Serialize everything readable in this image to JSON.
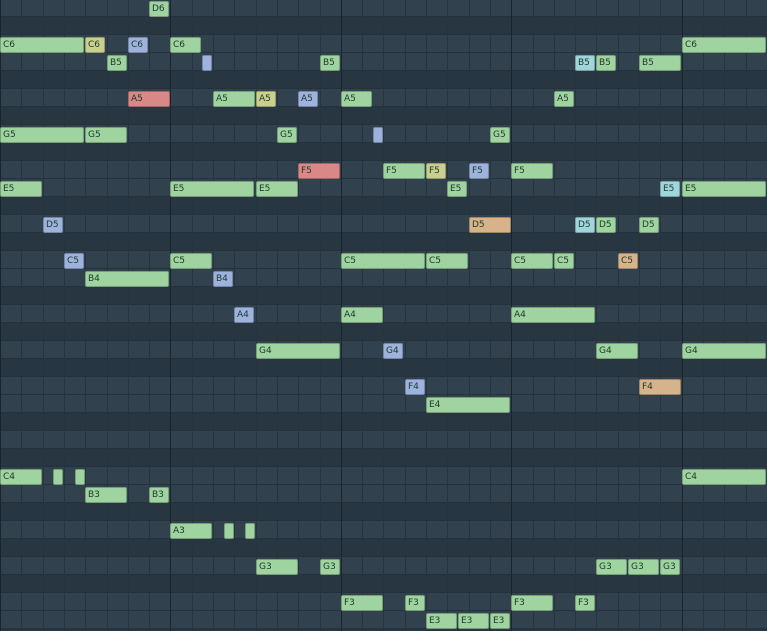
{
  "colors": {
    "green": "#9fd3a0",
    "yellow": "#c9cf8e",
    "blue": "#9db3de",
    "red": "#d98787",
    "tan": "#d6b38a",
    "cyan": "#9fd6dc"
  },
  "notes": [
    {
      "label": "D6",
      "color": "green"
    },
    {
      "label": "C6",
      "color": "green"
    },
    {
      "label": "C6",
      "color": "yellow"
    },
    {
      "label": "C6",
      "color": "blue"
    },
    {
      "label": "C6",
      "color": "green"
    },
    {
      "label": "C6",
      "color": "green"
    },
    {
      "label": "B5",
      "color": "green"
    },
    {
      "label": "",
      "color": "blue"
    },
    {
      "label": "B5",
      "color": "green"
    },
    {
      "label": "B5",
      "color": "cyan"
    },
    {
      "label": "B5",
      "color": "green"
    },
    {
      "label": "B5",
      "color": "green"
    },
    {
      "label": "A5",
      "color": "red"
    },
    {
      "label": "A5",
      "color": "green"
    },
    {
      "label": "A5",
      "color": "yellow"
    },
    {
      "label": "A5",
      "color": "blue"
    },
    {
      "label": "A5",
      "color": "green"
    },
    {
      "label": "A5",
      "color": "green"
    },
    {
      "label": "G5",
      "color": "green"
    },
    {
      "label": "G5",
      "color": "green"
    },
    {
      "label": "G5",
      "color": "green"
    },
    {
      "label": "",
      "color": "blue"
    },
    {
      "label": "G5",
      "color": "green"
    },
    {
      "label": "F5",
      "color": "red"
    },
    {
      "label": "F5",
      "color": "green"
    },
    {
      "label": "F5",
      "color": "yellow"
    },
    {
      "label": "F5",
      "color": "blue"
    },
    {
      "label": "F5",
      "color": "green"
    },
    {
      "label": "E5",
      "color": "green"
    },
    {
      "label": "E5",
      "color": "green"
    },
    {
      "label": "E5",
      "color": "green"
    },
    {
      "label": "E5",
      "color": "green"
    },
    {
      "label": "E5",
      "color": "cyan"
    },
    {
      "label": "E5",
      "color": "green"
    },
    {
      "label": "D5",
      "color": "blue"
    },
    {
      "label": "D5",
      "color": "tan"
    },
    {
      "label": "D5",
      "color": "cyan"
    },
    {
      "label": "D5",
      "color": "green"
    },
    {
      "label": "D5",
      "color": "green"
    },
    {
      "label": "C5",
      "color": "blue"
    },
    {
      "label": "C5",
      "color": "green"
    },
    {
      "label": "C5",
      "color": "green"
    },
    {
      "label": "C5",
      "color": "green"
    },
    {
      "label": "C5",
      "color": "green"
    },
    {
      "label": "C5",
      "color": "green"
    },
    {
      "label": "C5",
      "color": "tan"
    },
    {
      "label": "B4",
      "color": "green"
    },
    {
      "label": "B4",
      "color": "blue"
    },
    {
      "label": "A4",
      "color": "blue"
    },
    {
      "label": "A4",
      "color": "green"
    },
    {
      "label": "A4",
      "color": "green"
    },
    {
      "label": "G4",
      "color": "green"
    },
    {
      "label": "G4",
      "color": "blue"
    },
    {
      "label": "G4",
      "color": "green"
    },
    {
      "label": "G4",
      "color": "green"
    },
    {
      "label": "F4",
      "color": "blue"
    },
    {
      "label": "F4",
      "color": "tan"
    },
    {
      "label": "E4",
      "color": "green"
    },
    {
      "label": "C4",
      "color": "green"
    },
    {
      "label": "",
      "color": "green"
    },
    {
      "label": "",
      "color": "green"
    },
    {
      "label": "C4",
      "color": "green"
    },
    {
      "label": "B3",
      "color": "green"
    },
    {
      "label": "B3",
      "color": "green"
    },
    {
      "label": "A3",
      "color": "green"
    },
    {
      "label": "",
      "color": "green"
    },
    {
      "label": "",
      "color": "green"
    },
    {
      "label": "G3",
      "color": "green"
    },
    {
      "label": "G3",
      "color": "green"
    },
    {
      "label": "G3",
      "color": "green"
    },
    {
      "label": "G3",
      "color": "green"
    },
    {
      "label": "G3",
      "color": "green"
    },
    {
      "label": "F3",
      "color": "green"
    },
    {
      "label": "F3",
      "color": "green"
    },
    {
      "label": "F3",
      "color": "green"
    },
    {
      "label": "F3",
      "color": "green"
    },
    {
      "label": "E3",
      "color": "green"
    },
    {
      "label": "E3",
      "color": "green"
    },
    {
      "label": "E3",
      "color": "green"
    }
  ]
}
